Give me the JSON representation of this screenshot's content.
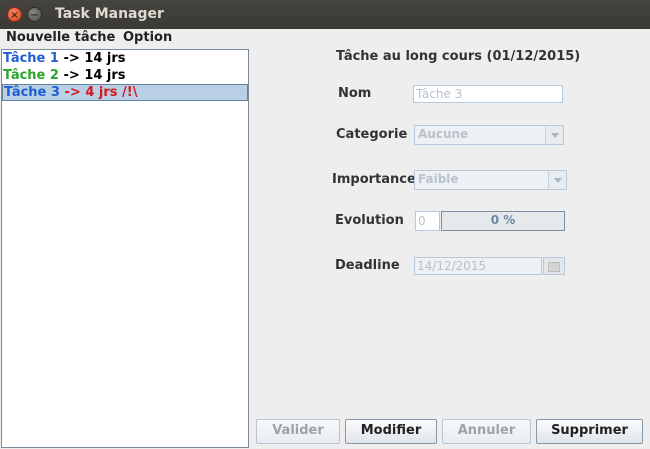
{
  "window": {
    "title": "Task Manager"
  },
  "menu": {
    "items": [
      "Nouvelle tâche",
      "Option"
    ]
  },
  "task_list": [
    {
      "name": "Tâche 1",
      "arrow": "->",
      "duration": "14 jrs",
      "suffix": "",
      "name_color": "#1f5fd1",
      "selected": false
    },
    {
      "name": "Tâche 2",
      "arrow": "->",
      "duration": "14 jrs",
      "suffix": "",
      "name_color": "#2aa52a",
      "selected": false
    },
    {
      "name": "Tâche 3",
      "arrow": "->",
      "duration": "4 jrs",
      "suffix": "/!\\",
      "name_color": "#1f5fd1",
      "selected": true
    }
  ],
  "detail": {
    "header": "Tâche au long cours (01/12/2015)",
    "nom": {
      "label": "Nom",
      "value": "Tâche 3"
    },
    "categorie": {
      "label": "Categorie",
      "value": "Aucune"
    },
    "importance": {
      "label": "Importance",
      "value": "Faible"
    },
    "evolution": {
      "label": "Evolution",
      "value": "0",
      "progress_text": "0 %",
      "progress": 0
    },
    "deadline": {
      "label": "Deadline",
      "value": "14/12/2015"
    }
  },
  "buttons": {
    "valider": "Valider",
    "modifier": "Modifier",
    "annuler": "Annuler",
    "supprimer": "Supprimer"
  },
  "colors": {
    "blue": "#1f5fd1",
    "green": "#2aa52a",
    "red": "#d4181c",
    "selection": "#b8cfe5"
  }
}
